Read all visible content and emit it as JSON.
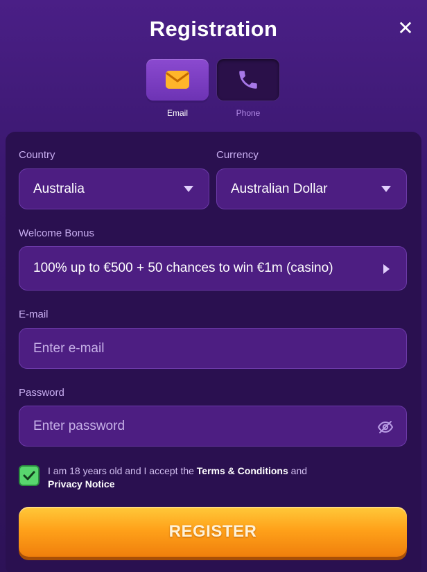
{
  "header": {
    "title": "Registration",
    "close_icon": "close-icon"
  },
  "methods": [
    {
      "label": "Email",
      "icon": "envelope-icon",
      "selected": true
    },
    {
      "label": "Phone",
      "icon": "phone-icon",
      "selected": false
    }
  ],
  "form": {
    "country": {
      "label": "Country",
      "value": "Australia"
    },
    "currency": {
      "label": "Currency",
      "value": "Australian Dollar"
    },
    "bonus": {
      "label": "Welcome Bonus",
      "value": "100% up to €500 + 50 chances to win €1m (casino)"
    },
    "email": {
      "label": "E-mail",
      "placeholder": "Enter e-mail"
    },
    "password": {
      "label": "Password",
      "placeholder": "Enter password",
      "toggle_icon": "eye-off-icon"
    }
  },
  "consent": {
    "checked": true,
    "text_before": "I am 18 years old and I accept the ",
    "terms_link": "Terms & Conditions",
    "text_middle": " and ",
    "privacy_link": "Privacy Notice"
  },
  "submit": {
    "label": "REGISTER"
  },
  "colors": {
    "background": "#3b1870",
    "panel": "#2a1050",
    "field": "#4d1e82",
    "accent_orange": "#ffa21a",
    "check_green": "#58d66e",
    "label_purple": "#c8aef0"
  }
}
